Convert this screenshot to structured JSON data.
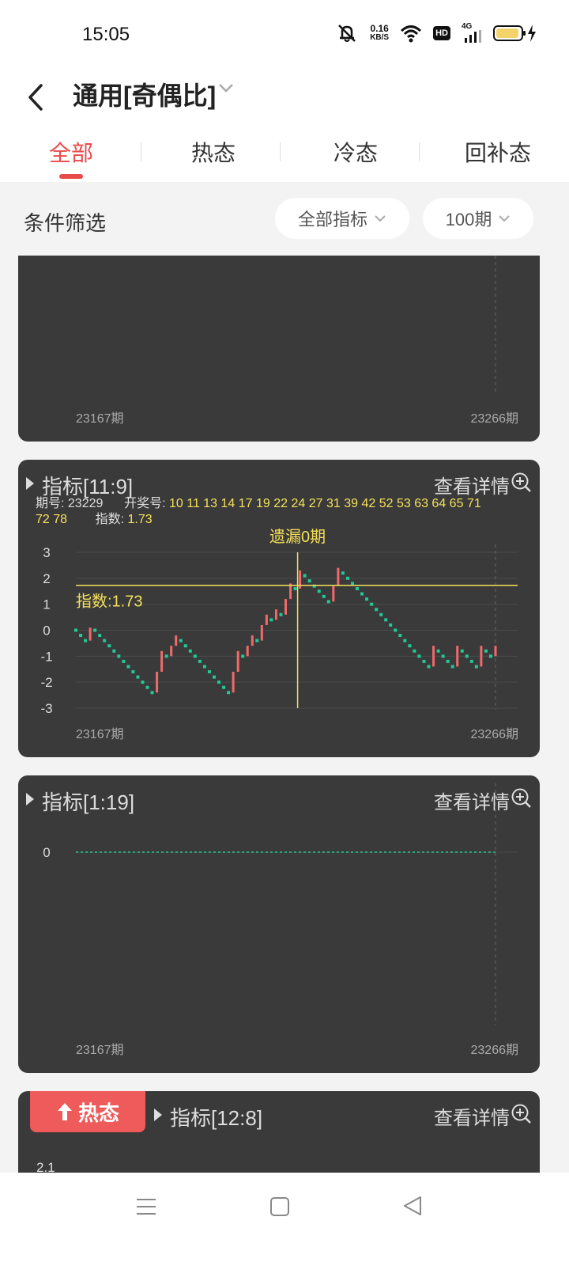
{
  "status_bar": {
    "time": "15:05",
    "net_speed": "0.16",
    "net_unit": "KB/S",
    "hd": "HD",
    "net_type": "4G"
  },
  "header": {
    "title": "通用[奇偶比]"
  },
  "tabs": [
    {
      "label": "全部",
      "active": true
    },
    {
      "label": "热态",
      "active": false
    },
    {
      "label": "冷态",
      "active": false
    },
    {
      "label": "回补态",
      "active": false
    }
  ],
  "filter": {
    "label": "条件筛选",
    "indicator_select": "全部指标",
    "period_select": "100期"
  },
  "cards": [
    {
      "x_start": "23167期",
      "x_end": "23266期"
    },
    {
      "name": "指标[11:9]",
      "detail": "查看详情",
      "period_label": "期号:",
      "period": "23229",
      "draw_label": "开奖号:",
      "draw_numbers_line1": "10 11 13 14 17 19 22 24 27 31 39 42 52 53 63 64 65 71",
      "draw_numbers_line2": "72 78",
      "index_label": "指数:",
      "index_value": "1.73",
      "cursor_label": "遗漏0期",
      "index_line_label": "指数:1.73",
      "x_start": "23167期",
      "x_end": "23266期"
    },
    {
      "name": "指标[1:19]",
      "detail": "查看详情",
      "y_tick": "0",
      "x_start": "23167期",
      "x_end": "23266期"
    },
    {
      "badge": "热态",
      "name": "指标[12:8]",
      "detail": "查看详情",
      "y_tick_top": "2.1"
    }
  ],
  "chart_data": {
    "type": "line",
    "title": "指标[11:9]",
    "x": [
      "23167期",
      "23266期"
    ],
    "yticks": [
      "3",
      "2",
      "1",
      "0",
      "-1",
      "-2",
      "-3"
    ],
    "ylim": [
      -3,
      3
    ],
    "index_line": 1.73,
    "cursor_period": "23229",
    "series": [
      {
        "values": [
          0,
          -0.2,
          -0.4,
          0.1,
          0,
          -0.2,
          -0.4,
          -0.6,
          -0.8,
          -1,
          -1.2,
          -1.4,
          -1.6,
          -1.8,
          -2,
          -2.2,
          -2.4,
          -1.6,
          -0.8,
          -1,
          -0.6,
          -0.2,
          -0.4,
          -0.6,
          -0.8,
          -1,
          -1.2,
          -1.4,
          -1.6,
          -1.8,
          -2,
          -2.2,
          -2.4,
          -1.6,
          -0.8,
          -1,
          -0.6,
          -0.2,
          -0.4,
          0.2,
          0.6,
          0.4,
          0.8,
          0.6,
          1.2,
          1.8,
          1.6,
          2.3,
          2.1,
          1.9,
          1.7,
          1.5,
          1.3,
          1.1,
          1.7,
          2.4,
          2.2,
          2,
          1.8,
          1.6,
          1.4,
          1.2,
          1,
          0.8,
          0.6,
          0.4,
          0.2,
          0,
          -0.2,
          -0.4,
          -0.6,
          -0.8,
          -1,
          -1.2,
          -1.4,
          -0.6,
          -0.8,
          -1,
          -1.2,
          -1.4,
          -0.6,
          -0.8,
          -1,
          -1.2,
          -1.4,
          -0.6,
          -0.8,
          -1,
          -0.6
        ]
      }
    ]
  }
}
